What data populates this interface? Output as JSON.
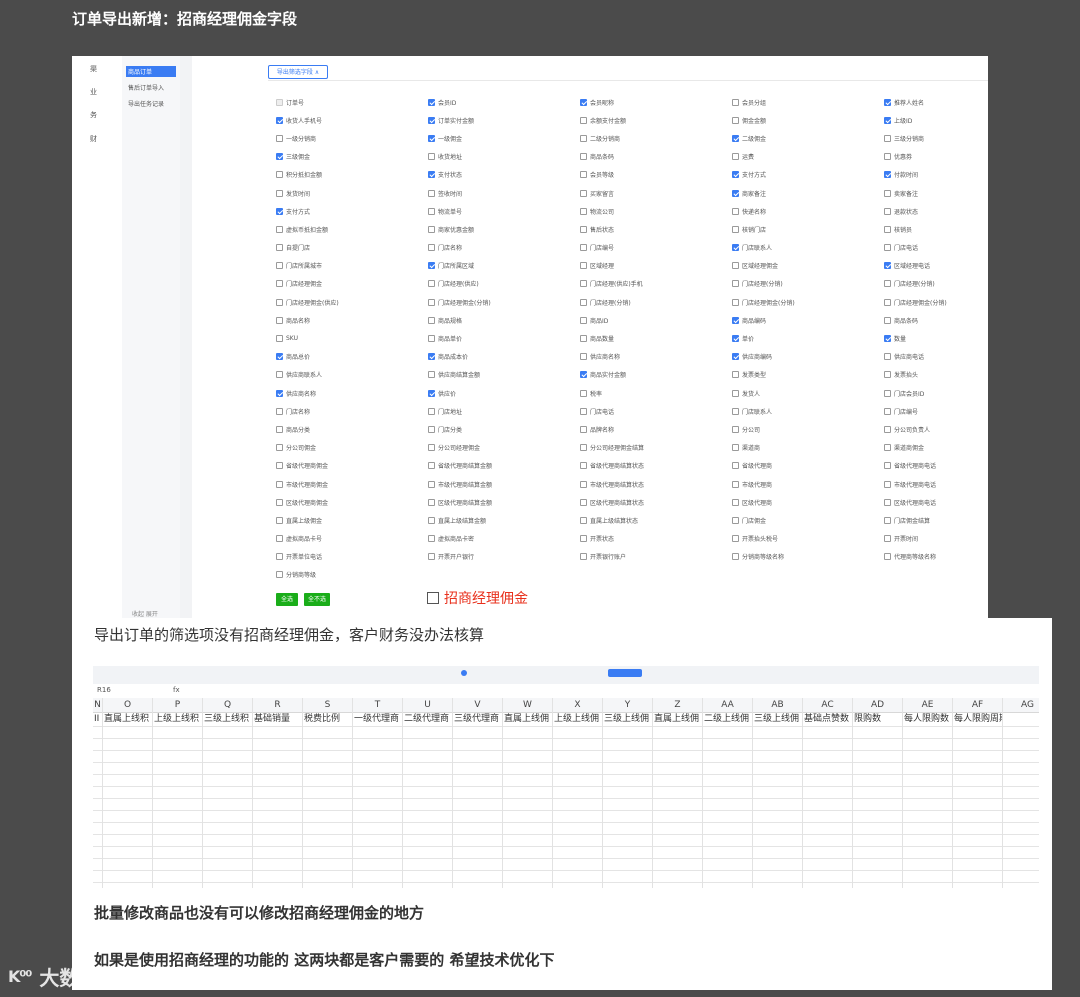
{
  "title": "订单导出新增：招商经理佣金字段",
  "left_nav": [
    "渠",
    "业",
    "务",
    "财"
  ],
  "sub_nav": {
    "items": [
      "商品订单",
      "售后订单导入",
      "导出任务记录"
    ],
    "active": 0,
    "footer": "收起 展开"
  },
  "filter_button": "导出筛选字段 ∧",
  "checkboxes": [
    {
      "label": "订单号",
      "checked": false,
      "disabled": true
    },
    {
      "label": "会员ID",
      "checked": true
    },
    {
      "label": "会员昵称",
      "checked": true
    },
    {
      "label": "会员分组",
      "checked": false
    },
    {
      "label": "推荐人姓名",
      "checked": true
    },
    {
      "label": "收货人手机号",
      "checked": true
    },
    {
      "label": "订单实付金额",
      "checked": true
    },
    {
      "label": "余额支付金额",
      "checked": false
    },
    {
      "label": "佣金金额",
      "checked": false
    },
    {
      "label": "上级ID",
      "checked": true
    },
    {
      "label": "一级分销商",
      "checked": false
    },
    {
      "label": "一级佣金",
      "checked": true
    },
    {
      "label": "二级分销商",
      "checked": false
    },
    {
      "label": "二级佣金",
      "checked": true
    },
    {
      "label": "三级分销商",
      "checked": false
    },
    {
      "label": "三级佣金",
      "checked": true
    },
    {
      "label": "收货地址",
      "checked": false
    },
    {
      "label": "商品条码",
      "checked": false
    },
    {
      "label": "运费",
      "checked": false
    },
    {
      "label": "优惠券",
      "checked": false
    },
    {
      "label": "积分抵扣金额",
      "checked": false
    },
    {
      "label": "支付状态",
      "checked": true
    },
    {
      "label": "会员等级",
      "checked": false
    },
    {
      "label": "支付方式",
      "checked": true
    },
    {
      "label": "付款时间",
      "checked": true
    },
    {
      "label": "发货时间",
      "checked": false
    },
    {
      "label": "签收时间",
      "checked": false
    },
    {
      "label": "买家留言",
      "checked": false
    },
    {
      "label": "商家备注",
      "checked": true
    },
    {
      "label": "卖家备注",
      "checked": false
    },
    {
      "label": "支付方式",
      "checked": true
    },
    {
      "label": "物流单号",
      "checked": false
    },
    {
      "label": "物流公司",
      "checked": false
    },
    {
      "label": "快递名称",
      "checked": false
    },
    {
      "label": "退款状态",
      "checked": false
    },
    {
      "label": "虚拟币抵扣金额",
      "checked": false
    },
    {
      "label": "商家优惠金额",
      "checked": false
    },
    {
      "label": "售后状态",
      "checked": false
    },
    {
      "label": "核销门店",
      "checked": false
    },
    {
      "label": "核销员",
      "checked": false
    },
    {
      "label": "自提门店",
      "checked": false
    },
    {
      "label": "门店名称",
      "checked": false
    },
    {
      "label": "门店编号",
      "checked": false
    },
    {
      "label": "门店联系人",
      "checked": true
    },
    {
      "label": "门店电话",
      "checked": false
    },
    {
      "label": "门店所属城市",
      "checked": false
    },
    {
      "label": "门店所属区域",
      "checked": true
    },
    {
      "label": "区域经理",
      "checked": false
    },
    {
      "label": "区域经理佣金",
      "checked": false
    },
    {
      "label": "区域经理电话",
      "checked": true
    },
    {
      "label": "门店经理佣金",
      "checked": false
    },
    {
      "label": "门店经理(供应)",
      "checked": false
    },
    {
      "label": "门店经理(供应)手机",
      "checked": false
    },
    {
      "label": "门店经理(分销)",
      "checked": false
    },
    {
      "label": "门店经理(分销)",
      "checked": false
    },
    {
      "label": "门店经理佣金(供应)",
      "checked": false
    },
    {
      "label": "门店经理佣金(分销)",
      "checked": false
    },
    {
      "label": "门店经理(分销)",
      "checked": false
    },
    {
      "label": "门店经理佣金(分销)",
      "checked": false
    },
    {
      "label": "门店经理佣金(分销)",
      "checked": false
    },
    {
      "label": "商品名称",
      "checked": false
    },
    {
      "label": "商品规格",
      "checked": false
    },
    {
      "label": "商品ID",
      "checked": false
    },
    {
      "label": "商品编码",
      "checked": true
    },
    {
      "label": "商品条码",
      "checked": false
    },
    {
      "label": "SKU",
      "checked": false
    },
    {
      "label": "商品单价",
      "checked": false
    },
    {
      "label": "商品数量",
      "checked": false
    },
    {
      "label": "单价",
      "checked": true
    },
    {
      "label": "数量",
      "checked": true
    },
    {
      "label": "商品总价",
      "checked": true
    },
    {
      "label": "商品成本价",
      "checked": true
    },
    {
      "label": "供应商名称",
      "checked": false
    },
    {
      "label": "供应商编码",
      "checked": true
    },
    {
      "label": "供应商电话",
      "checked": false
    },
    {
      "label": "供应商联系人",
      "checked": false
    },
    {
      "label": "供应商结算金额",
      "checked": false
    },
    {
      "label": "商品实付金额",
      "checked": true
    },
    {
      "label": "发票类型",
      "checked": false
    },
    {
      "label": "发票抬头",
      "checked": false
    },
    {
      "label": "供应商名称",
      "checked": true
    },
    {
      "label": "供应价",
      "checked": true
    },
    {
      "label": "税率",
      "checked": false
    },
    {
      "label": "发货人",
      "checked": false
    },
    {
      "label": "门店会员ID",
      "checked": false
    },
    {
      "label": "门店名称",
      "checked": false
    },
    {
      "label": "门店地址",
      "checked": false
    },
    {
      "label": "门店电话",
      "checked": false
    },
    {
      "label": "门店联系人",
      "checked": false
    },
    {
      "label": "门店编号",
      "checked": false
    },
    {
      "label": "商品分类",
      "checked": false
    },
    {
      "label": "门店分类",
      "checked": false
    },
    {
      "label": "品牌名称",
      "checked": false
    },
    {
      "label": "分公司",
      "checked": false
    },
    {
      "label": "分公司负责人",
      "checked": false
    },
    {
      "label": "分公司佣金",
      "checked": false
    },
    {
      "label": "分公司经理佣金",
      "checked": false
    },
    {
      "label": "分公司经理佣金结算",
      "checked": false
    },
    {
      "label": "渠道商",
      "checked": false
    },
    {
      "label": "渠道商佣金",
      "checked": false
    },
    {
      "label": "省级代理商佣金",
      "checked": false
    },
    {
      "label": "省级代理商结算金额",
      "checked": false
    },
    {
      "label": "省级代理商结算状态",
      "checked": false
    },
    {
      "label": "省级代理商",
      "checked": false
    },
    {
      "label": "省级代理商电话",
      "checked": false
    },
    {
      "label": "市级代理商佣金",
      "checked": false
    },
    {
      "label": "市级代理商结算金额",
      "checked": false
    },
    {
      "label": "市级代理商结算状态",
      "checked": false
    },
    {
      "label": "市级代理商",
      "checked": false
    },
    {
      "label": "市级代理商电话",
      "checked": false
    },
    {
      "label": "区级代理商佣金",
      "checked": false
    },
    {
      "label": "区级代理商结算金额",
      "checked": false
    },
    {
      "label": "区级代理商结算状态",
      "checked": false
    },
    {
      "label": "区级代理商",
      "checked": false
    },
    {
      "label": "区级代理商电话",
      "checked": false
    },
    {
      "label": "直属上级佣金",
      "checked": false
    },
    {
      "label": "直属上级结算金额",
      "checked": false
    },
    {
      "label": "直属上级结算状态",
      "checked": false
    },
    {
      "label": "门店佣金",
      "checked": false
    },
    {
      "label": "门店佣金结算",
      "checked": false
    },
    {
      "label": "虚拟商品卡号",
      "checked": false
    },
    {
      "label": "虚拟商品卡密",
      "checked": false
    },
    {
      "label": "开票状态",
      "checked": false
    },
    {
      "label": "开票抬头税号",
      "checked": false
    },
    {
      "label": "开票时间",
      "checked": false
    },
    {
      "label": "开票单位电话",
      "checked": false
    },
    {
      "label": "开票开户银行",
      "checked": false
    },
    {
      "label": "开票银行账户",
      "checked": false
    },
    {
      "label": "分销商等级名称",
      "checked": false
    },
    {
      "label": "代理商等级名称",
      "checked": false
    },
    {
      "label": "分销商等级",
      "checked": false
    }
  ],
  "buttons": {
    "select_all": "全选",
    "select_none": "全不选"
  },
  "annotation": "招商经理佣金",
  "note1": "导出订单的筛选项没有招商经理佣金，客户财务没办法核算",
  "sheet": {
    "cell_ref": "R16",
    "fx": "fx",
    "columns": [
      "N",
      "O",
      "P",
      "Q",
      "R",
      "S",
      "T",
      "U",
      "V",
      "W",
      "X",
      "Y",
      "Z",
      "AA",
      "AB",
      "AC",
      "AD",
      "AE",
      "AF",
      "AG"
    ],
    "row1": [
      "II",
      "直属上线积",
      "上级上线积",
      "三级上线积",
      "基础销量",
      "税费比例",
      "一级代理商",
      "二级代理商",
      "三级代理商",
      "直属上线佣",
      "上级上线佣",
      "三级上线佣",
      "直属上线佣",
      "二级上线佣",
      "三级上线佣",
      "基础点赞数",
      "限购数",
      "每人限购数",
      "每人限购周期",
      ""
    ]
  },
  "note2": "批量修改商品也没有可以修改招商经理佣金的地方",
  "note3": "如果是使用招商经理的功能的   这两块都是客户需要的   希望技术优化下",
  "watermark": {
    "logo": "K⁰⁰",
    "text": "大数跨境"
  },
  "colors": {
    "accent": "#3a7cf3",
    "green": "#1aad19",
    "annotation_red": "#e8301c",
    "background": "#4b4b4b"
  }
}
